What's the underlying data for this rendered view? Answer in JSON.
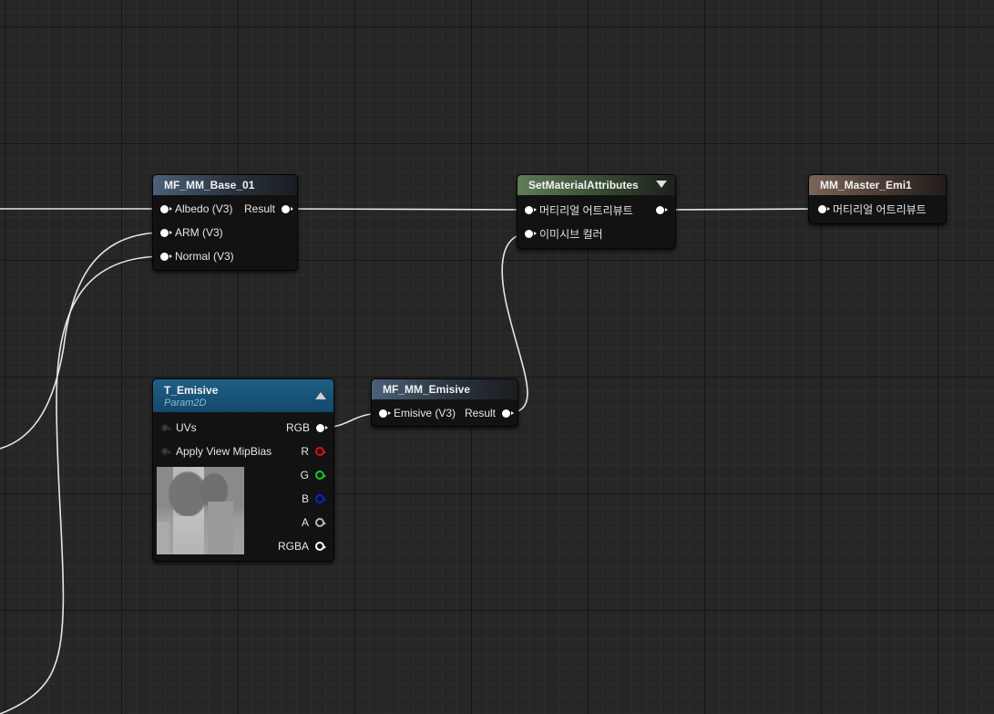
{
  "nodes": {
    "mf_base": {
      "title": "MF_MM_Base_01",
      "inputs": [
        "Albedo (V3)",
        "ARM (V3)",
        "Normal (V3)"
      ],
      "output": "Result"
    },
    "set_attributes": {
      "title": "SetMaterialAttributes",
      "inputs": [
        "머티리얼 어트리뷰트",
        "이미시브 컬러"
      ]
    },
    "master": {
      "title": "MM_Master_Emi1",
      "inputs": [
        "머티리얼 어트리뷰트"
      ]
    },
    "texture": {
      "title": "T_Emisive",
      "subtitle": "Param2D",
      "inputs": [
        "UVs",
        "Apply View MipBias"
      ],
      "outputs": [
        "RGB",
        "R",
        "G",
        "B",
        "A",
        "RGBA"
      ]
    },
    "mf_emisive": {
      "title": "MF_MM_Emisive",
      "input": "Emisive (V3)",
      "output": "Result"
    }
  },
  "colors": {
    "grid_background": "#262626",
    "wire": "#e8e8e8",
    "pin_red": "#e01010",
    "pin_green": "#10d020",
    "pin_blue": "#1020d8"
  },
  "icons": [
    "collapse-arrow-icon",
    "expand-arrow-icon",
    "pin-icon"
  ]
}
